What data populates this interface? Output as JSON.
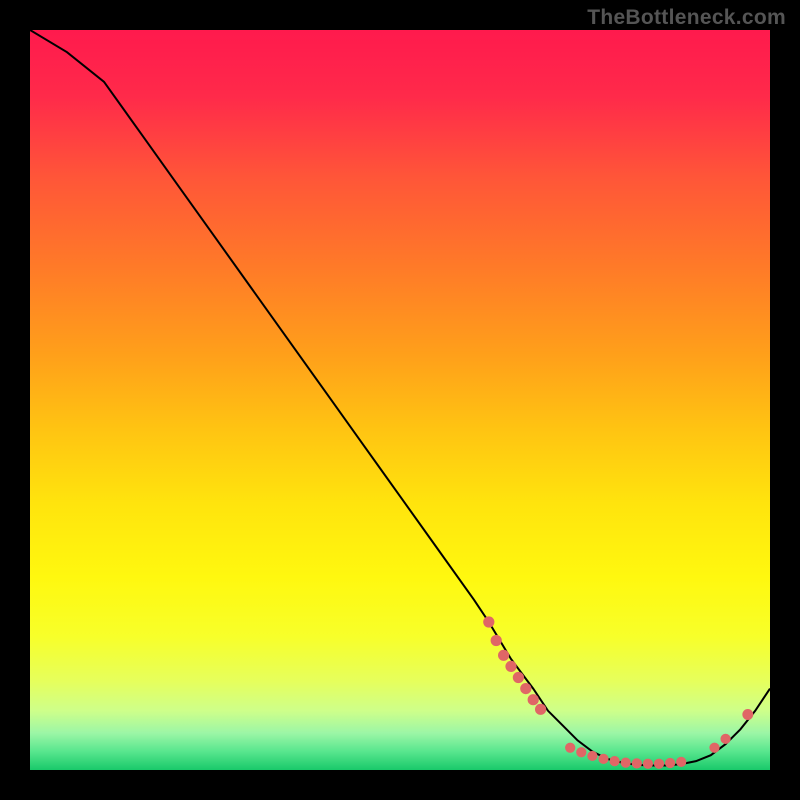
{
  "watermark": "TheBottleneck.com",
  "chart_data": {
    "type": "line",
    "title": "",
    "xlabel": "",
    "ylabel": "",
    "xlim": [
      0,
      100
    ],
    "ylim": [
      0,
      100
    ],
    "grid": false,
    "series": [
      {
        "name": "curve",
        "color": "#000000",
        "x": [
          0,
          5,
          10,
          15,
          20,
          25,
          30,
          35,
          40,
          45,
          50,
          55,
          60,
          62,
          65,
          68,
          70,
          72,
          74,
          76,
          78,
          80,
          82,
          84,
          86,
          88,
          90,
          92,
          94,
          96,
          98,
          100
        ],
        "y": [
          100,
          97,
          93,
          86,
          79,
          72,
          65,
          58,
          51,
          44,
          37,
          30,
          23,
          20,
          15,
          11,
          8,
          6,
          4,
          2.5,
          1.5,
          1,
          0.7,
          0.6,
          0.6,
          0.8,
          1.2,
          2,
          3.5,
          5.5,
          8,
          11
        ]
      }
    ],
    "markers": {
      "color": "#e06666",
      "points": [
        {
          "x": 62,
          "y": 20,
          "r": 3.5
        },
        {
          "x": 63,
          "y": 17.5,
          "r": 3.5
        },
        {
          "x": 64,
          "y": 15.5,
          "r": 3.5
        },
        {
          "x": 65,
          "y": 14,
          "r": 3.5
        },
        {
          "x": 66,
          "y": 12.5,
          "r": 3.5
        },
        {
          "x": 67,
          "y": 11,
          "r": 3.5
        },
        {
          "x": 68,
          "y": 9.5,
          "r": 3.5
        },
        {
          "x": 69,
          "y": 8.2,
          "r": 3.5
        },
        {
          "x": 73,
          "y": 3,
          "r": 3.2
        },
        {
          "x": 74.5,
          "y": 2.4,
          "r": 3.2
        },
        {
          "x": 76,
          "y": 1.9,
          "r": 3.2
        },
        {
          "x": 77.5,
          "y": 1.5,
          "r": 3.2
        },
        {
          "x": 79,
          "y": 1.2,
          "r": 3.2
        },
        {
          "x": 80.5,
          "y": 1.0,
          "r": 3.2
        },
        {
          "x": 82,
          "y": 0.9,
          "r": 3.2
        },
        {
          "x": 83.5,
          "y": 0.85,
          "r": 3.2
        },
        {
          "x": 85,
          "y": 0.85,
          "r": 3.2
        },
        {
          "x": 86.5,
          "y": 0.95,
          "r": 3.2
        },
        {
          "x": 88,
          "y": 1.1,
          "r": 3.2
        },
        {
          "x": 92.5,
          "y": 3,
          "r": 3.2
        },
        {
          "x": 94,
          "y": 4.2,
          "r": 3.2
        },
        {
          "x": 97,
          "y": 7.5,
          "r": 3.4
        }
      ]
    },
    "background_gradient": {
      "type": "vertical",
      "stops": [
        {
          "offset": 0.0,
          "color": "#ff1a4d"
        },
        {
          "offset": 0.09,
          "color": "#ff2a4a"
        },
        {
          "offset": 0.2,
          "color": "#ff5638"
        },
        {
          "offset": 0.32,
          "color": "#ff7a28"
        },
        {
          "offset": 0.44,
          "color": "#ffa01a"
        },
        {
          "offset": 0.54,
          "color": "#ffc412"
        },
        {
          "offset": 0.64,
          "color": "#ffe40d"
        },
        {
          "offset": 0.74,
          "color": "#fff80f"
        },
        {
          "offset": 0.82,
          "color": "#f7ff2a"
        },
        {
          "offset": 0.88,
          "color": "#e6ff5c"
        },
        {
          "offset": 0.92,
          "color": "#ceff8a"
        },
        {
          "offset": 0.95,
          "color": "#9cf6a6"
        },
        {
          "offset": 0.975,
          "color": "#58e68e"
        },
        {
          "offset": 1.0,
          "color": "#19c96a"
        }
      ]
    }
  }
}
